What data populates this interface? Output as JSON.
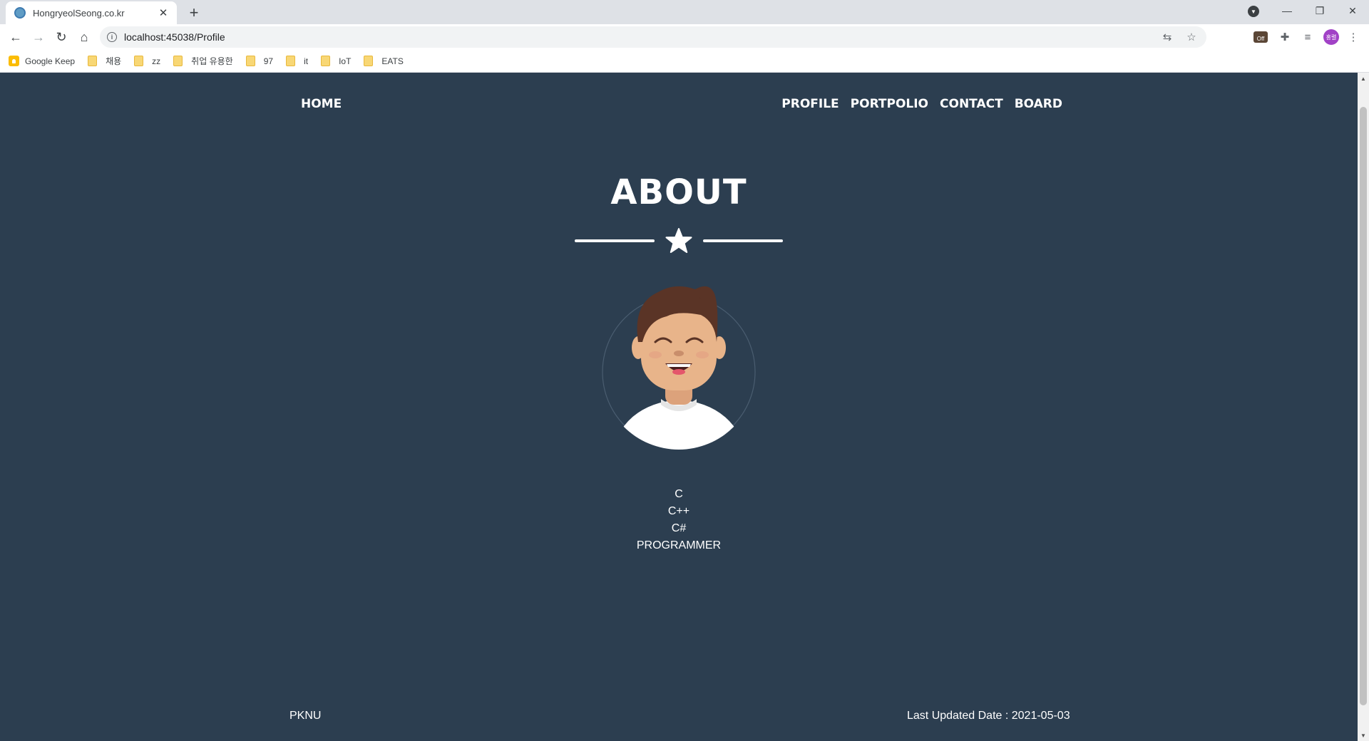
{
  "browser": {
    "tab_title": "HongryeolSeong.co.kr",
    "url": "localhost:45038/Profile",
    "bookmarks": [
      {
        "label": "Google Keep",
        "icon": "keep-icon"
      },
      {
        "label": "채용",
        "icon": "folder-icon"
      },
      {
        "label": "zz",
        "icon": "folder-icon"
      },
      {
        "label": "취업 유용한",
        "icon": "folder-icon"
      },
      {
        "label": "97",
        "icon": "folder-icon"
      },
      {
        "label": "it",
        "icon": "folder-icon"
      },
      {
        "label": "IoT",
        "icon": "folder-icon"
      },
      {
        "label": "EATS",
        "icon": "folder-icon"
      }
    ],
    "extension_badge": "Off",
    "profile_initials": "홍렬"
  },
  "nav": {
    "brand": "HOME",
    "items": [
      "PROFILE",
      "PORTPOLIO",
      "CONTACT",
      "BOARD"
    ]
  },
  "about": {
    "title": "ABOUT",
    "skills": [
      "C",
      "C++",
      "C#",
      "PROGRAMMER"
    ]
  },
  "footer": {
    "left": "PKNU",
    "right": "Last Updated Date : 2021-05-03"
  },
  "colors": {
    "background": "#2c3e50",
    "text": "#ffffff",
    "skin": "#e8b48a",
    "hair": "#5a3426"
  }
}
